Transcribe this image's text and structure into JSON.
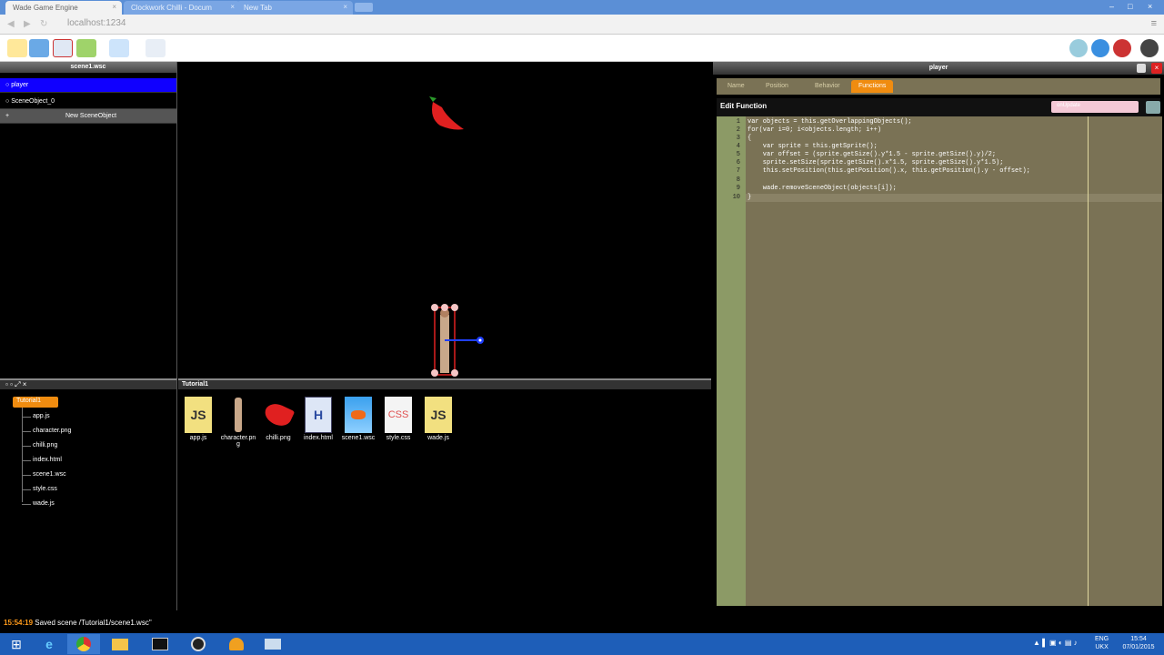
{
  "browser": {
    "tabs": [
      {
        "label": "Wade Game Engine",
        "active": true
      },
      {
        "label": "Clockwork Chilli - Docum",
        "active": false
      },
      {
        "label": "New Tab",
        "active": false
      }
    ],
    "url": "localhost:1234"
  },
  "scene_panel": {
    "title": "scene1.wsc",
    "items": [
      {
        "label": "player",
        "selected": true
      },
      {
        "label": "SceneObject_0",
        "selected": false
      }
    ],
    "add_label": "New SceneObject"
  },
  "tree": {
    "root": "Tutorial1",
    "files": [
      "app.js",
      "character.png",
      "chilli.png",
      "index.html",
      "scene1.wsc",
      "style.css",
      "wade.js"
    ]
  },
  "assets": {
    "folder": "Tutorial1",
    "items": [
      {
        "label": "app.js",
        "icon": "js-file-icon"
      },
      {
        "label": "character.pn g",
        "icon": "character-thumbnail"
      },
      {
        "label": "chilli.png",
        "icon": "chilli-thumbnail"
      },
      {
        "label": "index.html",
        "icon": "html-file-icon"
      },
      {
        "label": "scene1.wsc",
        "icon": "scene-file-icon"
      },
      {
        "label": "style.css",
        "icon": "css-file-icon"
      },
      {
        "label": "wade.js",
        "icon": "js-file-icon"
      }
    ]
  },
  "editor": {
    "title": "player",
    "tabs": [
      {
        "label": "Name",
        "active": false
      },
      {
        "label": "Position",
        "active": false
      },
      {
        "label": "Behavior",
        "active": false
      },
      {
        "label": "Functions",
        "active": true
      }
    ],
    "section_label": "Edit Function",
    "selected_function": "onUpdate",
    "code_lines": [
      "var objects = this.getOverlappingObjects();",
      "for(var i=0; i<objects.length; i++)",
      "{",
      "    var sprite = this.getSprite();",
      "    var offset = (sprite.getSize().y*1.5 - sprite.getSize().y)/2;",
      "    sprite.setSize(sprite.getSize().x*1.5, sprite.getSize().y*1.5);",
      "    this.setPosition(this.getPosition().x, this.getPosition().y - offset);",
      "",
      "    wade.removeSceneObject(objects[i]);",
      "}"
    ],
    "line_numbers": [
      "1",
      "2",
      "3",
      "4",
      "5",
      "6",
      "7",
      "8",
      "9",
      "10"
    ]
  },
  "status": {
    "time": "15:54:19",
    "message": "Saved scene /Tutorial1/scene1.wsc\""
  },
  "taskbar": {
    "lang": "ENG",
    "region": "UKX",
    "clock": "15:54",
    "date": "07/01/2015"
  },
  "colors": {
    "selected": "#1000ff",
    "accent": "#f08c10",
    "editor_bg": "#7a7255",
    "gutter_bg": "#8c9a66",
    "taskbar": "#1e5eb8"
  }
}
